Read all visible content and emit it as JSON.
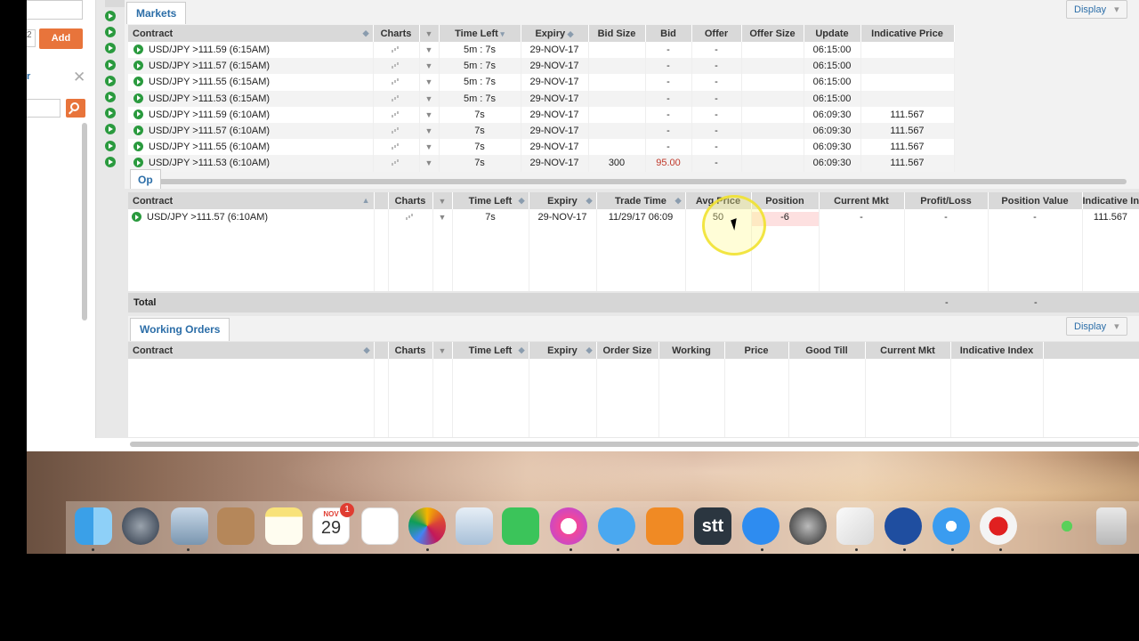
{
  "left_panel": {
    "field_value": "2",
    "add_label": "Add",
    "close_glyph": "✕",
    "tab_glyph": "r"
  },
  "markets": {
    "tab_label": "Markets",
    "display_label": "Display",
    "columns": [
      "Contract",
      "Charts",
      "",
      "Time Left",
      "Expiry",
      "Bid Size",
      "Bid",
      "Offer",
      "Offer Size",
      "Update",
      "Indicative Price"
    ],
    "rows": [
      {
        "contract": "USD/JPY >111.59 (6:15AM)",
        "time_left": "5m : 7s",
        "expiry": "29-NOV-17",
        "bid_size": "",
        "bid": "-",
        "offer": "-",
        "offer_size": "",
        "update": "06:15:00",
        "indicative": ""
      },
      {
        "contract": "USD/JPY >111.57 (6:15AM)",
        "time_left": "5m : 7s",
        "expiry": "29-NOV-17",
        "bid_size": "",
        "bid": "-",
        "offer": "-",
        "offer_size": "",
        "update": "06:15:00",
        "indicative": ""
      },
      {
        "contract": "USD/JPY >111.55 (6:15AM)",
        "time_left": "5m : 7s",
        "expiry": "29-NOV-17",
        "bid_size": "",
        "bid": "-",
        "offer": "-",
        "offer_size": "",
        "update": "06:15:00",
        "indicative": ""
      },
      {
        "contract": "USD/JPY >111.53 (6:15AM)",
        "time_left": "5m : 7s",
        "expiry": "29-NOV-17",
        "bid_size": "",
        "bid": "-",
        "offer": "-",
        "offer_size": "",
        "update": "06:15:00",
        "indicative": ""
      },
      {
        "contract": "USD/JPY >111.59 (6:10AM)",
        "time_left": "7s",
        "expiry": "29-NOV-17",
        "bid_size": "",
        "bid": "-",
        "offer": "-",
        "offer_size": "",
        "update": "06:09:30",
        "indicative": "111.567"
      },
      {
        "contract": "USD/JPY >111.57 (6:10AM)",
        "time_left": "7s",
        "expiry": "29-NOV-17",
        "bid_size": "",
        "bid": "-",
        "offer": "-",
        "offer_size": "",
        "update": "06:09:30",
        "indicative": "111.567"
      },
      {
        "contract": "USD/JPY >111.55 (6:10AM)",
        "time_left": "7s",
        "expiry": "29-NOV-17",
        "bid_size": "",
        "bid": "-",
        "offer": "-",
        "offer_size": "",
        "update": "06:09:30",
        "indicative": "111.567"
      },
      {
        "contract": "USD/JPY >111.53 (6:10AM)",
        "time_left": "7s",
        "expiry": "29-NOV-17",
        "bid_size": "300",
        "bid": "95.00",
        "offer": "-",
        "offer_size": "",
        "update": "06:09:30",
        "indicative": "111.567"
      }
    ]
  },
  "positions": {
    "tab_label": "Op",
    "columns": [
      "Contract",
      "",
      "Charts",
      "",
      "Time Left",
      "Expiry",
      "Trade Time",
      "Avg Price",
      "Position",
      "Current Mkt",
      "Profit/Loss",
      "Position Value",
      "Indicative Index"
    ],
    "rows": [
      {
        "contract": "USD/JPY >111.57 (6:10AM)",
        "time_left": "7s",
        "expiry": "29-NOV-17",
        "trade_time": "11/29/17 06:09",
        "avg_price": "50",
        "position": "-6",
        "current_mkt": "-",
        "profit_loss": "-",
        "position_value": "-",
        "indicative_index": "111.567"
      }
    ],
    "total_label": "Total",
    "total_profit_loss": "-",
    "total_position_value": "-"
  },
  "working_orders": {
    "tab_label": "Working Orders",
    "display_label": "Display",
    "columns": [
      "Contract",
      "",
      "Charts",
      "",
      "Time Left",
      "Expiry",
      "Order Size",
      "Working",
      "Price",
      "Good Till",
      "Current Mkt",
      "Indicative Index"
    ]
  },
  "dock": {
    "calendar_month": "NOV",
    "calendar_day": "29",
    "calendar_badge": "1",
    "stt_label": "stt"
  },
  "colors": {
    "accent_orange": "#e8743b",
    "tab_blue": "#2c6ea8",
    "play_green": "#2a9a3e",
    "bid_red": "#c0392b"
  }
}
